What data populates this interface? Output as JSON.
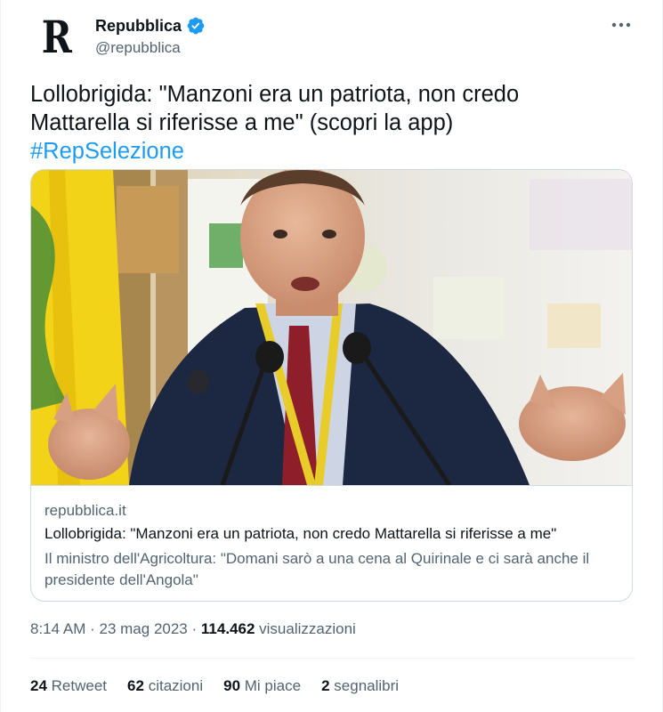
{
  "author": {
    "name": "Repubblica",
    "handle": "@repubblica",
    "avatar_letter": "R",
    "verified": true
  },
  "tweet": {
    "line1": "Lollobrigida: \"Manzoni era un patriota, non credo",
    "line2": "Mattarella si riferisse a me\" (scopri la app)",
    "hashtag": "#RepSelezione"
  },
  "card": {
    "domain": "repubblica.it",
    "title": "Lollobrigida: \"Manzoni era un patriota, non credo Mattarella si riferisse a me\"",
    "description": "Il ministro dell'Agricoltura: \"Domani sarò a una cena al Quirinale e ci sarà anche il presidente dell'Angola\""
  },
  "meta": {
    "time": "8:14 AM",
    "date": "23 mag 2023",
    "separator": "·",
    "views_count": "114.462",
    "views_label": "visualizzazioni"
  },
  "stats": [
    {
      "count": "24",
      "label": "Retweet"
    },
    {
      "count": "62",
      "label": "citazioni"
    },
    {
      "count": "90",
      "label": "Mi piace"
    },
    {
      "count": "2",
      "label": "segnalibri"
    }
  ],
  "colors": {
    "accent": "#1d9bf0",
    "text": "#0f1419",
    "secondary": "#536471",
    "border": "#cfd9de"
  },
  "icons": {
    "verified": "verified-badge-icon",
    "more": "more-options-icon"
  }
}
